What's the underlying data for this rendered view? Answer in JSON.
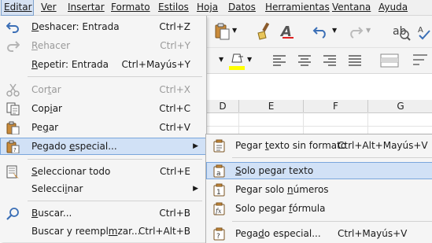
{
  "menubar": {
    "items": [
      "Editar",
      "Ver",
      "Insertar",
      "Formato",
      "Estilos",
      "Hoja",
      "Datos",
      "Herramientas",
      "Ventana",
      "Ayuda"
    ],
    "active": "Editar"
  },
  "sheet": {
    "columns": [
      "D",
      "E",
      "F",
      "G"
    ]
  },
  "edit_menu": {
    "items": [
      {
        "label": "Deshacer: Entrada",
        "shortcut": "Ctrl+Z",
        "icon": "undo-icon",
        "enabled": true
      },
      {
        "label": "Rehacer",
        "shortcut": "Ctrl+Y",
        "icon": "redo-icon",
        "enabled": false
      },
      {
        "label": "Repetir: Entrada",
        "shortcut": "Ctrl+Mayús+Y",
        "icon": "",
        "enabled": true
      },
      {
        "label": "Cortar",
        "shortcut": "Ctrl+X",
        "icon": "scissors-icon",
        "enabled": false
      },
      {
        "label": "Copiar",
        "shortcut": "Ctrl+C",
        "icon": "copy-icon",
        "enabled": true
      },
      {
        "label": "Pegar",
        "shortcut": "Ctrl+V",
        "icon": "paste-icon",
        "enabled": true
      },
      {
        "label": "Pegado especial...",
        "shortcut": "",
        "icon": "paste-special-icon",
        "enabled": true,
        "submenu": true,
        "highlighted": true
      },
      {
        "label": "Seleccionar todo",
        "shortcut": "Ctrl+E",
        "icon": "select-all-icon",
        "enabled": true
      },
      {
        "label": "Seleccionar",
        "shortcut": "",
        "icon": "",
        "enabled": true,
        "submenu": true
      },
      {
        "label": "Buscar...",
        "shortcut": "Ctrl+B",
        "icon": "search-icon",
        "enabled": true
      },
      {
        "label": "Buscar y reemplazar...",
        "shortcut": "Ctrl+Alt+B",
        "icon": "",
        "enabled": true
      }
    ]
  },
  "paste_submenu": {
    "items": [
      {
        "label": "Pegar texto sin formato",
        "shortcut": "Ctrl+Alt+Mayús+V",
        "icon": "paste-unformatted-icon"
      },
      {
        "label": "Solo pegar texto",
        "shortcut": "",
        "icon": "paste-text-only-icon",
        "highlighted": true
      },
      {
        "label": "Pegar solo números",
        "shortcut": "",
        "icon": "paste-numbers-only-icon"
      },
      {
        "label": "Solo pegar fórmula",
        "shortcut": "",
        "icon": "paste-formula-only-icon"
      },
      {
        "label": "Pegado especial...",
        "shortcut": "Ctrl+Mayús+V",
        "icon": "paste-special-icon"
      }
    ]
  },
  "colors": {
    "highlight": "#d1e1f6",
    "highlight_border": "#7aa6dc",
    "font_color_red": "#e02020",
    "highlight_yellow": "#ffff00"
  }
}
